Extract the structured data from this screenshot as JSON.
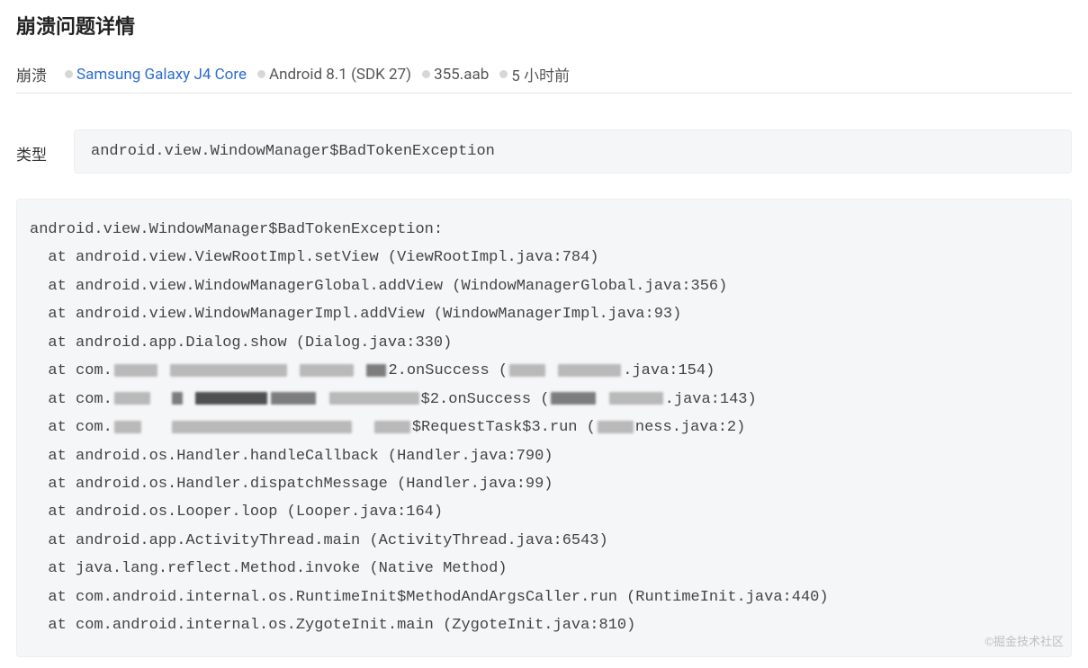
{
  "page": {
    "title": "崩溃问题详情"
  },
  "meta": {
    "label": "崩溃",
    "device": "Samsung Galaxy J4 Core",
    "os": "Android 8.1 (SDK 27)",
    "bundle": "355.aab",
    "time": "5 小时前"
  },
  "type": {
    "label": "类型",
    "value": "android.view.WindowManager$BadTokenException"
  },
  "trace": {
    "header": "android.view.WindowManager$BadTokenException:",
    "lines": [
      "  at android.view.ViewRootImpl.setView (ViewRootImpl.java:784)",
      "  at android.view.WindowManagerGlobal.addView (WindowManagerGlobal.java:356)",
      "  at android.view.WindowManagerImpl.addView (WindowManagerImpl.java:93)",
      "  at android.app.Dialog.show (Dialog.java:330)"
    ],
    "lines2": [
      "  at android.os.Handler.handleCallback (Handler.java:790)",
      "  at android.os.Handler.dispatchMessage (Handler.java:99)",
      "  at android.os.Looper.loop (Looper.java:164)",
      "  at android.app.ActivityThread.main (ActivityThread.java:6543)",
      "  at java.lang.reflect.Method.invoke (Native Method)",
      "  at com.android.internal.os.RuntimeInit$MethodAndArgsCaller.run (RuntimeInit.java:440)",
      "  at com.android.internal.os.ZygoteInit.main (ZygoteInit.java:810)"
    ],
    "partial": {
      "l5": {
        "pre": "  at com.",
        "mid": "2.onSuccess (",
        "post": ".java:154)"
      },
      "l6": {
        "pre": "  at com.",
        "mid": "$2.onSuccess (",
        "post": ".java:143)"
      },
      "l7": {
        "pre": "  at com.",
        "mid": "$RequestTask$3.run (",
        "frag": "ness.java:2)"
      }
    }
  },
  "watermark": "©掘金技术社区"
}
